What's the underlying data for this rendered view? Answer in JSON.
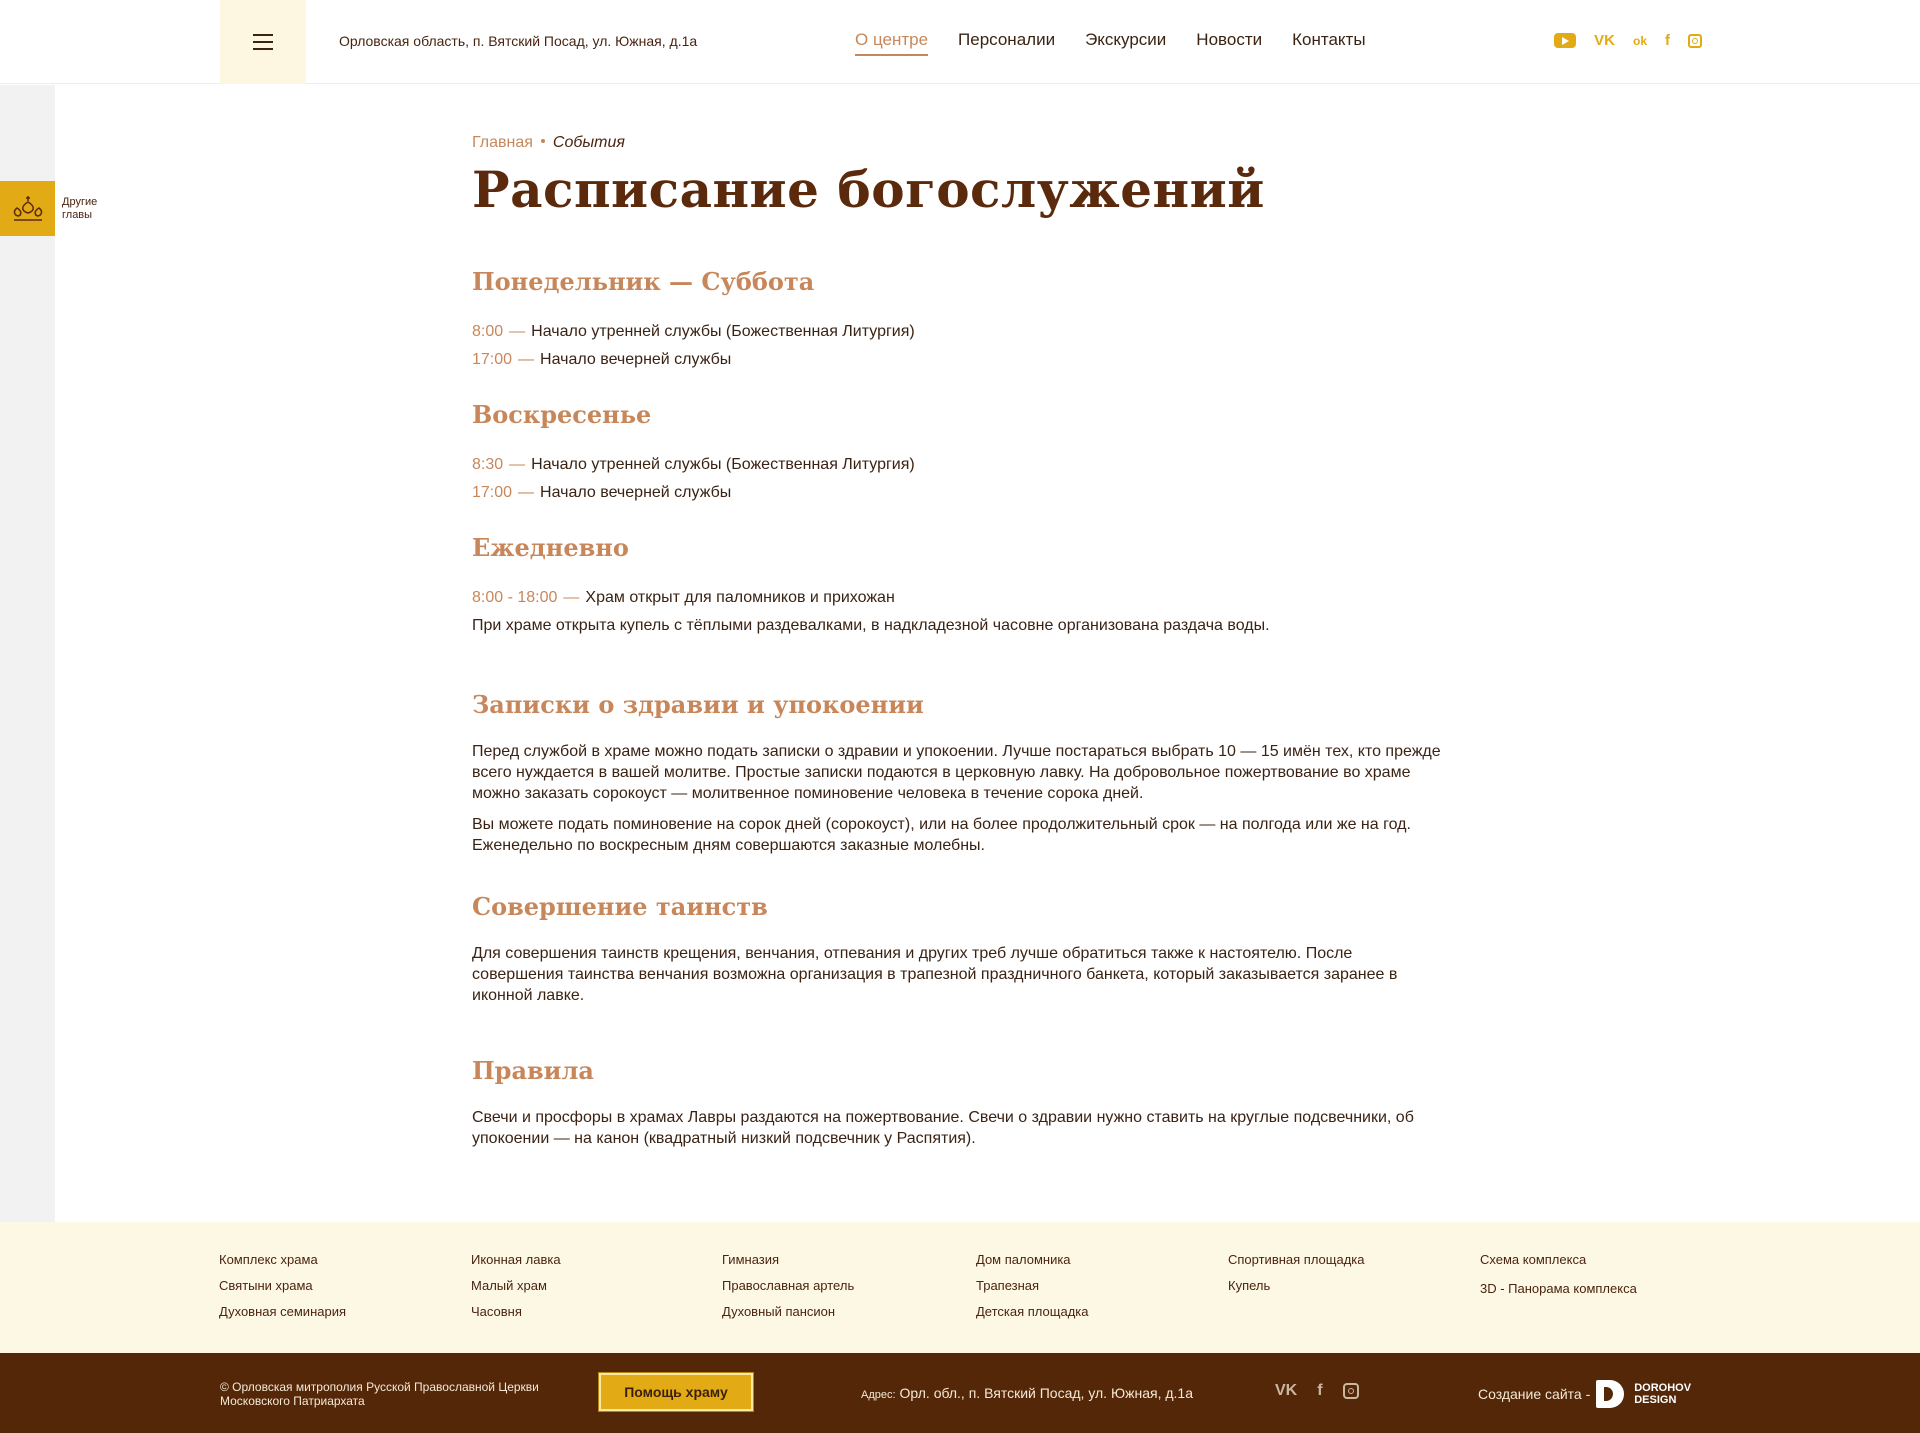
{
  "header": {
    "address": "Орловская область, п. Вятский Посад, ул. Южная, д.1а",
    "nav": [
      "О центре",
      "Персоналии",
      "Экскурсии",
      "Новости",
      "Контакты"
    ],
    "social_icons": [
      "youtube-icon",
      "vk-icon",
      "ok-icon",
      "facebook-icon",
      "instagram-icon"
    ],
    "vk": "VK",
    "ok": "ok",
    "fb": "f"
  },
  "sidebar": {
    "label": "Другие главы"
  },
  "breadcrumb": {
    "home": "Главная",
    "current": "События"
  },
  "page_title": "Расписание богослужений",
  "schedule": [
    {
      "heading": "Понедельник — Суббота",
      "rows": [
        {
          "time": "8:00",
          "text": "Начало утренней службы (Божественная Литургия)"
        },
        {
          "time": "17:00",
          "text": "Начало вечерней службы"
        }
      ]
    },
    {
      "heading": "Воскресенье",
      "rows": [
        {
          "time": "8:30",
          "text": "Начало утренней службы (Божественная Литургия)"
        },
        {
          "time": "17:00",
          "text": "Начало вечерней службы"
        }
      ]
    },
    {
      "heading": "Ежедневно",
      "rows": [
        {
          "time": "8:00 - 18:00",
          "text": "Храм открыт для паломников и прихожан"
        }
      ],
      "note": "При храме открыта купель с тёплыми раздевалками, в надкладезной часовне организована раздача воды."
    }
  ],
  "dash": "—",
  "sections": [
    {
      "heading": "Записки о здравии и упокоении",
      "paragraphs": [
        "Перед службой в храме можно подать записки о здравии и упокоении. Лучше постараться выбрать 10 — 15 имён тех, кто прежде всего нуждается в вашей молитве. Простые записки подаются в церковную лавку. На добровольное пожертвование во храме можно заказать сорокоуст — молитвенное поминовение человека в течение сорока дней.",
        "Вы можете подать поминовение на сорок дней (сорокоуст), или на более продолжительный срок — на полгода или же на год. Еженедельно по воскресным дням совершаются заказные молебны."
      ]
    },
    {
      "heading": "Совершение таинств",
      "paragraphs": [
        "Для совершения таинств крещения, венчания, отпевания и других треб лучше обратиться также к настоятелю. После совершения таинства венчания возможна организация в трапезной праздничного банкета, который заказывается заранее в иконной лавке."
      ]
    },
    {
      "heading": "Правила",
      "paragraphs": [
        "Свечи и просфоры в храмах Лавры раздаются на пожертвование. Свечи о здравии нужно ставить на круглые подсвечники, об упокоении — на канон (квадратный низкий подсвечник у Распятия)."
      ]
    }
  ],
  "footer_links": [
    [
      "Комплекс храма",
      "Святыни храма",
      "Духовная семинария"
    ],
    [
      "Иконная лавка",
      "Малый храм",
      "Часовня"
    ],
    [
      "Гимназия",
      "Православная артель",
      "Духовный пансион"
    ],
    [
      "Дом паломника",
      "Трапезная",
      "Детская площадка"
    ],
    [
      "Спортивная площадка",
      "Купель"
    ],
    [
      "Схема комплекса",
      "3D - Панорама комплекса"
    ]
  ],
  "bottom": {
    "copyright": "© Орловская митрополия Русской Православной Церкви Московского Патриархата",
    "help_button": "Помощь храму",
    "address_key": "Адрес:",
    "address": "Орл. обл.,  п. Вятский Посад, ул. Южная, д.1а",
    "maker_label": "Создание сайта -",
    "maker_brand_1": "DOROHOV",
    "maker_brand_2": "DESIGN"
  },
  "colors": {
    "accent": "#c8875a",
    "gold": "#e2aa14",
    "brown": "#532708",
    "cream": "#fdf8e4"
  }
}
